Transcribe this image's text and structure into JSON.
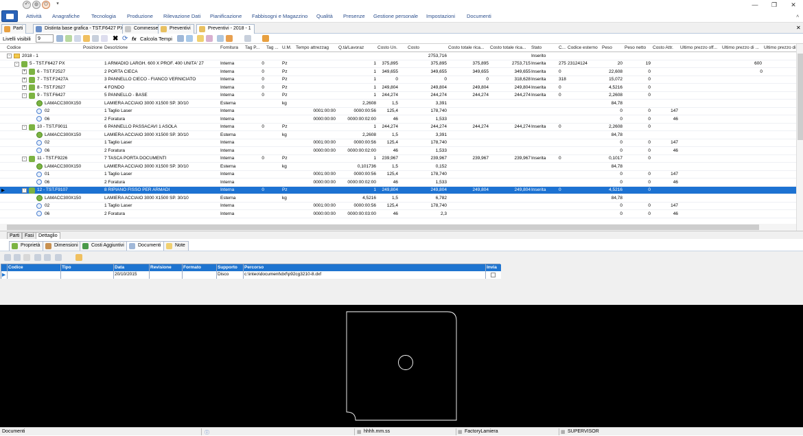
{
  "menu": [
    "Attività",
    "Anagrafiche",
    "Tecnologia",
    "Produzione",
    "Rilevazione Dati",
    "Pianificazione",
    "Fabbisogni e Magazzino",
    "Qualità",
    "Presenze",
    "Gestione personale",
    "Impostazioni",
    "Documenti"
  ],
  "doc_tabs": [
    "Parti",
    "Distinta base grafica - TST.F6427 PX",
    "Commesse",
    "Preventivi",
    "Preventivi - 2018 - 1"
  ],
  "toolbar": {
    "levels_label": "Livelli visibili",
    "levels_value": "9",
    "calc_label": "Calcola Tempi",
    "fx": "fx"
  },
  "columns": [
    "Codice",
    "Posizione",
    "Descrizione",
    "Fornitura",
    "Tag P...",
    "Tag ...",
    "U.M.",
    "Tempo attrezzag",
    "Q.tà/Lavoraz",
    "Costo Un.",
    "Costo",
    "Costo totale rica...",
    "Costo totale rica...",
    "Stato",
    "C...",
    "Codice esterno",
    "Peso",
    "Peso netto",
    "Costo Attr.",
    "Ultimo prezzo off...",
    "Ultimo prezzo di ...",
    "Ultimo prezzo di ..."
  ],
  "rows": [
    {
      "lvl": 0,
      "exp": "-",
      "icon": "fold",
      "codice": "2018 - 1",
      "costo": "2753,716",
      "stato": "Inserito"
    },
    {
      "lvl": 1,
      "exp": "-",
      "icon": "node",
      "codice": "5 - TST.F6427 PX",
      "desc": "1 ARMADIO LARGH. 600 X PROF. 400 UNITA' 27",
      "forn": "Interna",
      "tagp": "0",
      "um": "Pz",
      "qta": "1",
      "cun": "375,895",
      "costo": "375,895",
      "ctr1": "375,895",
      "ctr2": "2753,715",
      "stato": "Inserita",
      "c": "275",
      "cest": "23124124",
      "peso": "20",
      "pesonetto": "19",
      "upo": "600"
    },
    {
      "lvl": 2,
      "exp": "+",
      "icon": "node",
      "codice": "6 - TST.F2527",
      "desc": "2 PORTA CIECA",
      "forn": "Interna",
      "tagp": "0",
      "um": "Pz",
      "qta": "1",
      "cun": "349,655",
      "costo": "349,655",
      "ctr1": "349,655",
      "ctr2": "349,655",
      "stato": "Inserita",
      "c": "0",
      "peso": "22,608",
      "pesonetto": "0",
      "upd": "0"
    },
    {
      "lvl": 2,
      "exp": "+",
      "icon": "node",
      "codice": "7 - TST.F2427A",
      "desc": "3 PANNELLO CIECO - FIANCO VERNICIATO",
      "forn": "Interna",
      "tagp": "0",
      "um": "Pz",
      "qta": "1",
      "cun": "0",
      "costo": "0",
      "ctr1": "0",
      "ctr2": "318,628",
      "stato": "Inserita",
      "c": "318",
      "peso": "15,072",
      "pesonetto": "0"
    },
    {
      "lvl": 2,
      "exp": "+",
      "icon": "node",
      "codice": "8 - TST.F2627",
      "desc": "4 FONDO",
      "forn": "Interna",
      "tagp": "0",
      "um": "Pz",
      "qta": "1",
      "cun": "249,804",
      "costo": "249,804",
      "ctr1": "249,804",
      "ctr2": "249,804",
      "stato": "Inserita",
      "c": "0",
      "peso": "4,5216",
      "pesonetto": "0"
    },
    {
      "lvl": 2,
      "exp": "-",
      "icon": "node",
      "codice": "9 - TST.F6427",
      "desc": "5 PANNELLO - BASE",
      "forn": "Interna",
      "tagp": "0",
      "um": "Pz",
      "qta": "1",
      "cun": "244,274",
      "costo": "244,274",
      "ctr1": "244,274",
      "ctr2": "244,274",
      "stato": "Inserita",
      "c": "0",
      "peso": "2,2608",
      "pesonetto": "0"
    },
    {
      "lvl": 3,
      "icon": "sheet",
      "codice": "LAMACC300X150",
      "desc": "LAMIERA ACCIAIO 3000 X1500 SP. 30/10",
      "forn": "Esterna",
      "um": "kg",
      "qta": "2,2608",
      "cun": "1,5",
      "costo": "3,391",
      "peso": "84,78"
    },
    {
      "lvl": 3,
      "icon": "disc",
      "codice": "02",
      "desc": "1 Taglio Laser",
      "forn": "Interna",
      "tatt": "0001:00:00",
      "qta": "0000:00:56",
      "cun": "125,4",
      "costo": "178,740",
      "peso": "0",
      "pesonetto": "0",
      "cattr": "147"
    },
    {
      "lvl": 3,
      "icon": "disc",
      "codice": "06",
      "desc": "2 Foratura",
      "forn": "Interna",
      "tatt": "0000:00:00",
      "qta": "0000:00:02:00",
      "cun": "46",
      "costo": "1,533",
      "peso": "0",
      "pesonetto": "0",
      "cattr": "46"
    },
    {
      "lvl": 2,
      "exp": "-",
      "icon": "node",
      "codice": "10 - TST.F9011",
      "desc": "6 PANNELLO PASSACAVI 1 ASOLA",
      "forn": "Interna",
      "tagp": "0",
      "um": "Pz",
      "qta": "1",
      "cun": "244,274",
      "costo": "244,274",
      "ctr1": "244,274",
      "ctr2": "244,274",
      "stato": "Inserita",
      "c": "0",
      "peso": "2,2608",
      "pesonetto": "0"
    },
    {
      "lvl": 3,
      "icon": "sheet",
      "codice": "LAMACC300X150",
      "desc": "LAMIERA ACCIAIO 3000 X1500 SP. 30/10",
      "forn": "Esterna",
      "um": "kg",
      "qta": "2,2608",
      "cun": "1,5",
      "costo": "3,391",
      "peso": "84,78"
    },
    {
      "lvl": 3,
      "icon": "disc",
      "codice": "02",
      "desc": "1 Taglio Laser",
      "forn": "Interna",
      "tatt": "0001:00:00",
      "qta": "0000:00:56",
      "cun": "125,4",
      "costo": "178,740",
      "peso": "0",
      "pesonetto": "0",
      "cattr": "147"
    },
    {
      "lvl": 3,
      "icon": "disc",
      "codice": "06",
      "desc": "2 Foratura",
      "forn": "Interna",
      "tatt": "0000:00:00",
      "qta": "0000:00:02:00",
      "cun": "46",
      "costo": "1,533",
      "peso": "0",
      "pesonetto": "0",
      "cattr": "46"
    },
    {
      "lvl": 2,
      "exp": "-",
      "icon": "node",
      "codice": "11 - TST.F9226",
      "desc": "7 TASCA PORTA DOCUMENTI",
      "forn": "Interna",
      "tagp": "0",
      "um": "Pz",
      "qta": "1",
      "cun": "239,967",
      "costo": "239,967",
      "ctr1": "239,967",
      "ctr2": "239,967",
      "stato": "Inserita",
      "c": "0",
      "peso": "0,1017",
      "pesonetto": "0"
    },
    {
      "lvl": 3,
      "icon": "sheet",
      "codice": "LAMACC300X150",
      "desc": "LAMIERA ACCIAIO 3000 X1500 SP. 30/10",
      "forn": "Esterna",
      "um": "kg",
      "qta": "0,101736",
      "cun": "1,5",
      "costo": "0,152",
      "peso": "84,78"
    },
    {
      "lvl": 3,
      "icon": "disc",
      "codice": "01",
      "desc": "1 Taglio Laser",
      "forn": "Interna",
      "tatt": "0001:00:00",
      "qta": "0000:00:56",
      "cun": "125,4",
      "costo": "178,740",
      "peso": "0",
      "pesonetto": "0",
      "cattr": "147"
    },
    {
      "lvl": 3,
      "icon": "disc",
      "codice": "06",
      "desc": "2 Foratura",
      "forn": "Interna",
      "tatt": "0000:00:00",
      "qta": "0000:00:02:00",
      "cun": "46",
      "costo": "1,533",
      "peso": "0",
      "pesonetto": "0",
      "cattr": "46"
    },
    {
      "lvl": 2,
      "exp": "-",
      "icon": "node",
      "codice": "12 - TST.F9107",
      "desc": "8 RIPIANO FISSO PER ARMADI",
      "forn": "Interna",
      "tagp": "0",
      "um": "Pz",
      "qta": "1",
      "cun": "249,804",
      "costo": "249,804",
      "ctr1": "249,804",
      "ctr2": "249,804",
      "stato": "Inserita",
      "c": "0",
      "peso": "4,5216",
      "pesonetto": "0",
      "selected": true
    },
    {
      "lvl": 3,
      "icon": "sheet",
      "codice": "LAMACC300X150",
      "desc": "LAMIERA ACCIAIO 3000 X1500 SP. 30/10",
      "forn": "Esterna",
      "um": "kg",
      "qta": "4,5216",
      "cun": "1,5",
      "costo": "6,782",
      "peso": "84,78"
    },
    {
      "lvl": 3,
      "icon": "disc",
      "codice": "02",
      "desc": "1 Taglio Laser",
      "forn": "Interna",
      "tatt": "0001:00:00",
      "qta": "0000:00:56",
      "cun": "125,4",
      "costo": "178,740",
      "peso": "0",
      "pesonetto": "0",
      "cattr": "147"
    },
    {
      "lvl": 3,
      "icon": "disc",
      "codice": "06",
      "desc": "2 Foratura",
      "forn": "Interna",
      "tatt": "0000:00:00",
      "qta": "0000:00:03:00",
      "cun": "46",
      "costo": "2,3",
      "peso": "0",
      "pesonetto": "0",
      "cattr": "46"
    }
  ],
  "bottom_tabs": [
    "Parti",
    "Fasi",
    "Dettaglio"
  ],
  "detail_tabs": [
    "Proprietà",
    "Dimensioni",
    "Costi Aggiuntivi",
    "Documenti",
    "Note"
  ],
  "doc_columns": [
    "Codice",
    "Tipo",
    "Data",
    "Revisione",
    "Formato",
    "Supporto",
    "Percorso",
    "Invia"
  ],
  "doc_row": {
    "data": "20/10/2015",
    "supporto": "Disco",
    "percorso": "c:\\inteo\\document\\dxf\\p92cg3210-8.dxf"
  },
  "status": {
    "left": "Documenti",
    "time": "hhhh.mm.ss",
    "company": "FactoryLamiera",
    "user": "SUPERVISOR"
  },
  "colors": {
    "accent": "#1c72d2",
    "menu_text": "#2b4e8c",
    "viewer_bg": "#000000",
    "drawing_stroke": "#ffffff"
  }
}
